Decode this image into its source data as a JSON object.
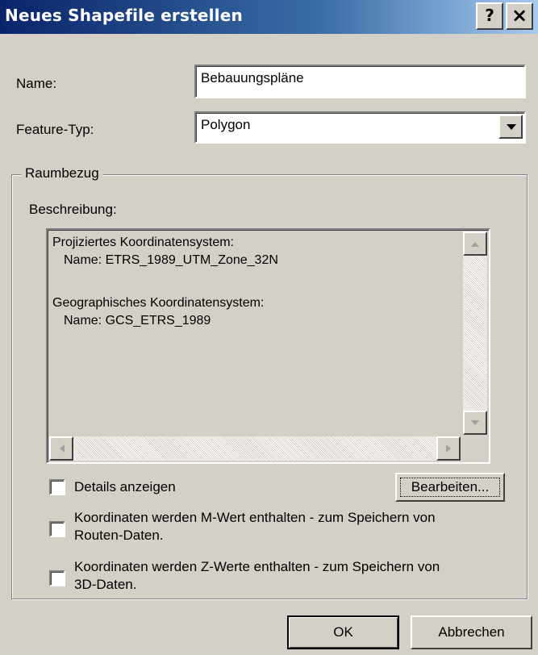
{
  "window": {
    "title": "Neues Shapefile erstellen",
    "help_label": "?",
    "close_label": "×"
  },
  "form": {
    "name_label": "Name:",
    "name_value": "Bebauungspläne",
    "feature_type_label": "Feature-Typ:",
    "feature_type_value": "Polygon"
  },
  "spatial_reference": {
    "group_label": "Raumbezug",
    "description_label": "Beschreibung:",
    "description_lines": [
      "Projiziertes Koordinatensystem:",
      "  Name: ETRS_1989_UTM_Zone_32N",
      "",
      "Geographisches Koordinatensystem:",
      "  Name: GCS_ETRS_1989"
    ],
    "details_label": "Details anzeigen",
    "edit_label": "Bearbeiten..."
  },
  "options": [
    {
      "label_line1": "Koordinaten werden M-Wert enthalten - zum Speichern von",
      "label_line2": "Routen-Daten.",
      "checked": false
    },
    {
      "label_line1": "Koordinaten werden Z-Werte enthalten - zum Speichern von",
      "label_line2": "3D-Daten.",
      "checked": false
    }
  ],
  "buttons": {
    "ok": "OK",
    "cancel": "Abbrechen"
  },
  "colors": {
    "title_bar_start": "#0a246a",
    "title_bar_end": "#a6caf0",
    "dialog_background": "#d4d0c8"
  }
}
